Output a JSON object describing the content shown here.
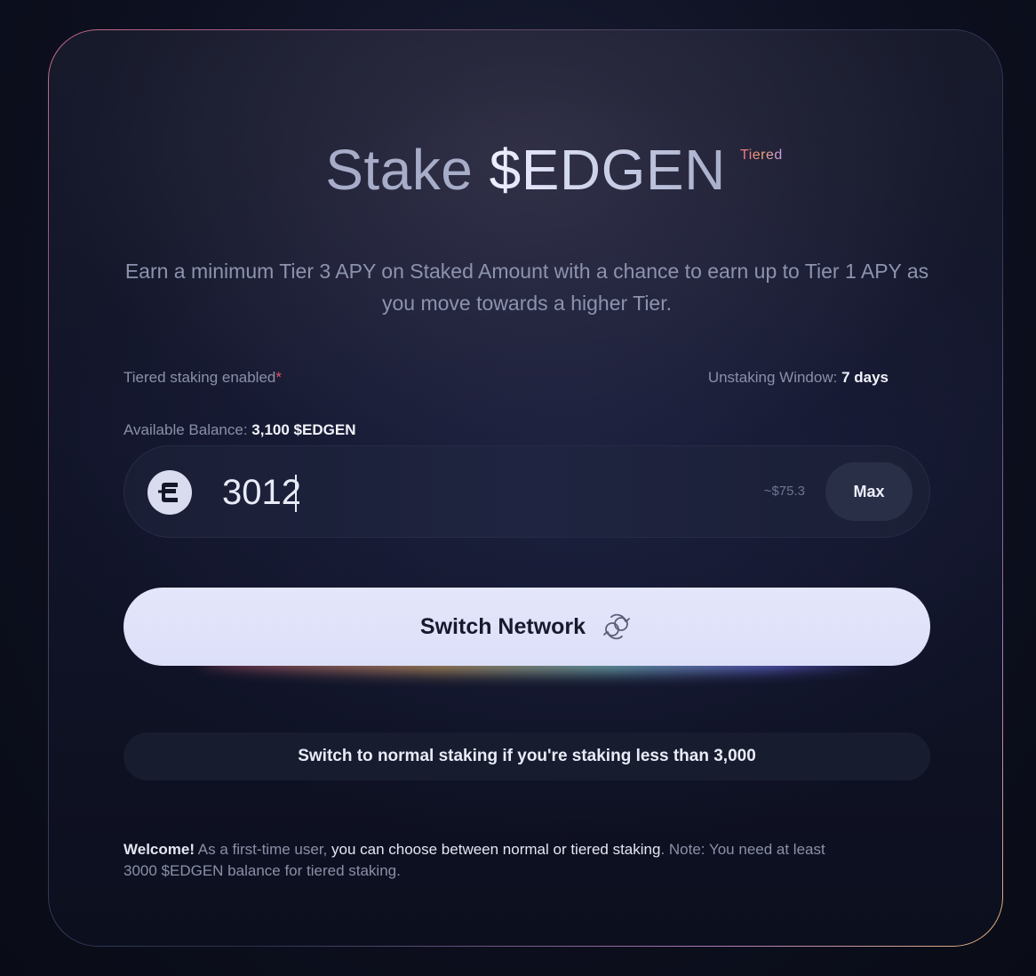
{
  "header": {
    "title_prefix": "Stake ",
    "title_token": "$EDGEN",
    "badge": "Tiered"
  },
  "subtitle": "Earn a minimum Tier 3 APY on Staked Amount with a chance to earn up to Tier 1 APY as you move towards a higher Tier.",
  "info": {
    "tiered_label": "Tiered staking enabled",
    "tiered_asterisk": "*",
    "unstaking_label": "Unstaking Window: ",
    "unstaking_value": "7 days",
    "balance_label": "Available Balance: ",
    "balance_value": "3,100 $EDGEN"
  },
  "amount": {
    "value": "3012",
    "usd_estimate": "~$75.3",
    "max_label": "Max",
    "token_icon": "edgen-coin-icon"
  },
  "actions": {
    "switch_network_label": "Switch Network",
    "switch_network_icon": "chain-link-icon",
    "normal_staking_label": "Switch to normal staking if you're staking less than 3,000"
  },
  "welcome": {
    "bold": "Welcome!",
    "part1": " As a first-time user, ",
    "part2": "you can choose between normal or tiered staking",
    "part3": ". Note: You need at least 3000 $EDGEN balance for tiered staking."
  },
  "colors": {
    "accent_red": "#e2566a",
    "button_bg": "#dcdff8",
    "card_bg": "#12152a"
  }
}
